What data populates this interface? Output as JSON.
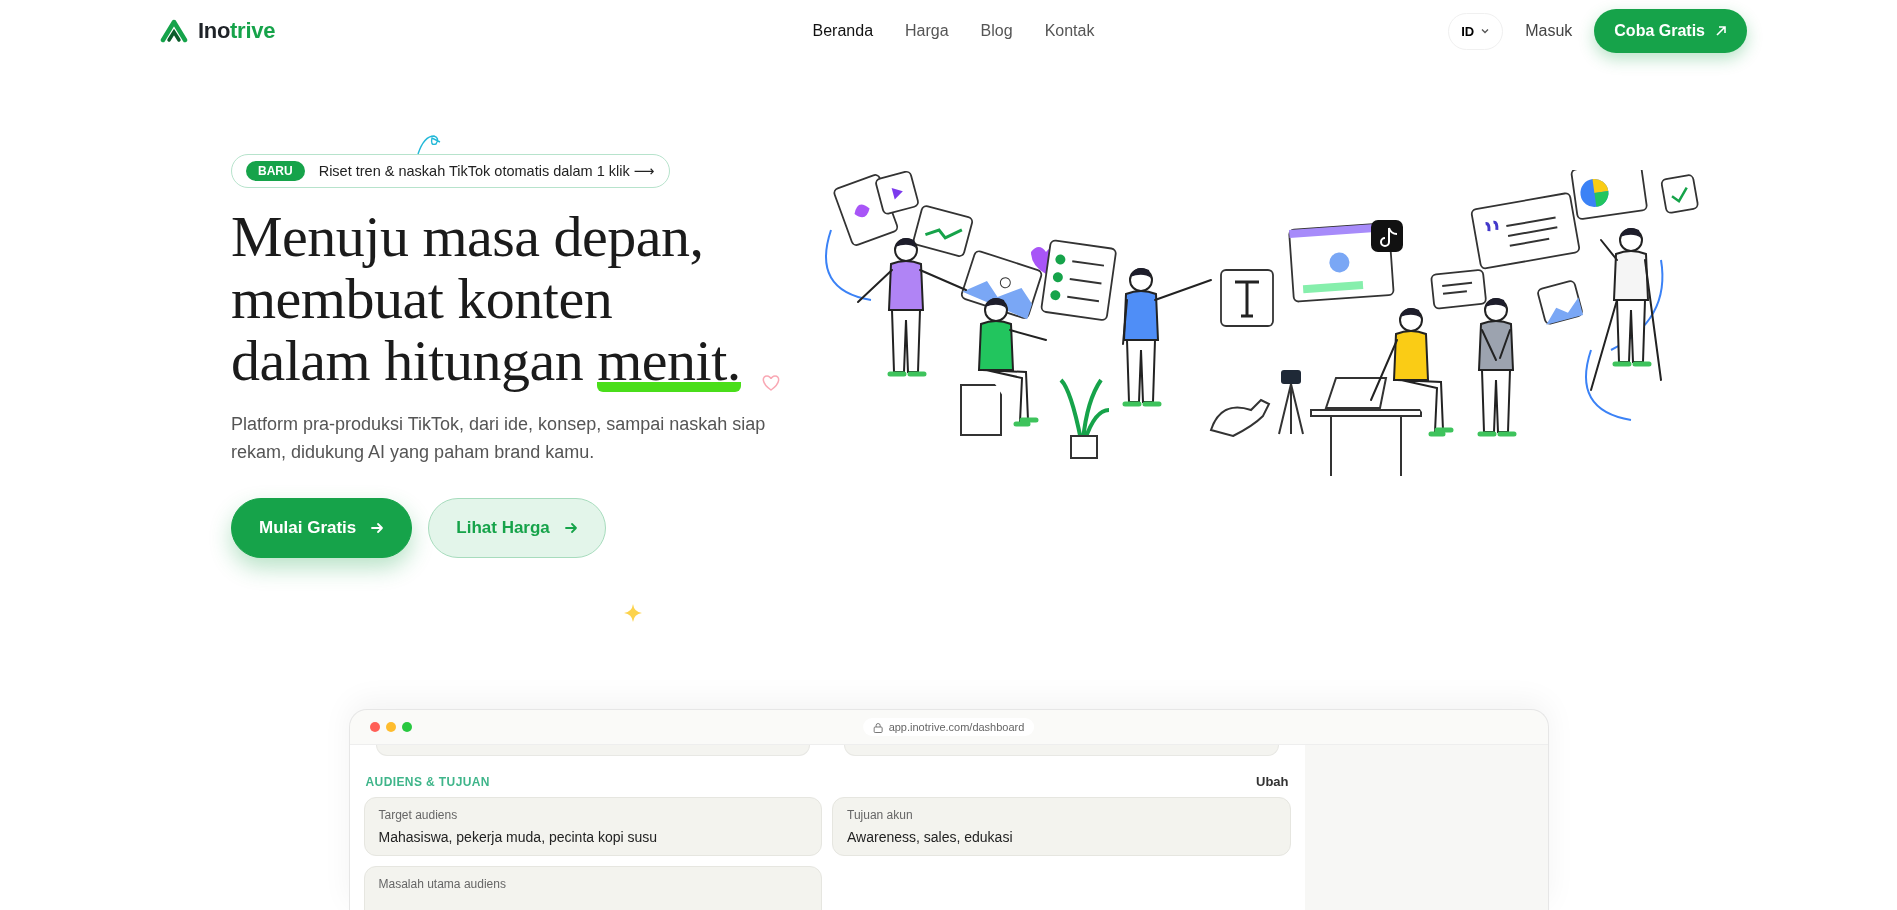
{
  "brand": {
    "name_dark": "Ino",
    "name_accent": "trive"
  },
  "nav": [
    {
      "label": "Beranda",
      "selected": true
    },
    {
      "label": "Harga",
      "selected": false
    },
    {
      "label": "Blog",
      "selected": false
    },
    {
      "label": "Kontak",
      "selected": false
    }
  ],
  "language": "ID",
  "login": "Masuk",
  "cta": "Coba Gratis",
  "hero": {
    "badge": {
      "tag": "BARU",
      "text": "Riset tren & naskah TikTok otomatis dalam 1 klik ⟶"
    },
    "headline_lines": [
      "Menuju masa depan,",
      "membuat konten",
      "dalam hitungan"
    ],
    "headline_highlight": "menit.",
    "subtitle": "Platform pra-produksi TikTok, dari ide, konsep, sampai naskah siap rekam, didukung AI yang paham brand kamu.",
    "buttons": [
      {
        "label": "Mulai Gratis",
        "kind": "primary"
      },
      {
        "label": "Lihat Harga",
        "kind": "secondary"
      }
    ]
  },
  "preview": {
    "url": "app.inotrive.com/dashboard",
    "section_title": "AUDIENS & TUJUAN",
    "edit": "Ubah",
    "fields": [
      {
        "label": "Target audiens",
        "value": "Mahasiswa, pekerja muda, pecinta kopi susu"
      },
      {
        "label": "Tujuan akun",
        "value": "Awareness, sales, edukasi"
      },
      {
        "label": "Masalah utama audiens"
      }
    ]
  }
}
